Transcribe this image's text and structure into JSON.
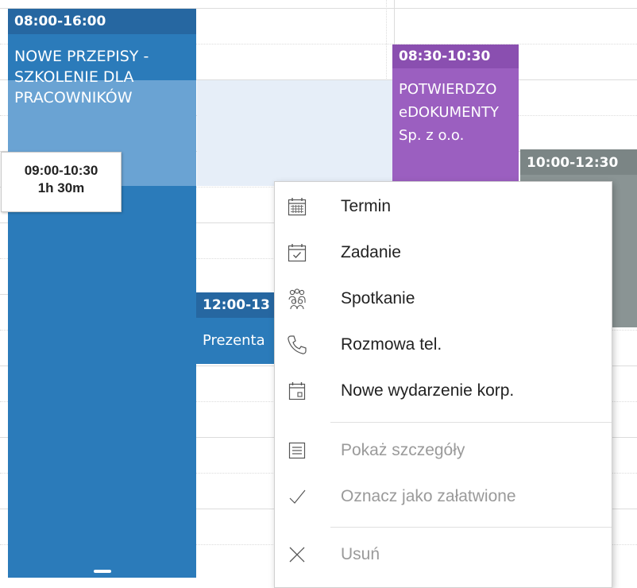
{
  "calendar": {
    "events": [
      {
        "id": "ev1",
        "time": "08:00-16:00",
        "title": "NOWE PRZEPISY -\nSZKOLENIE DLA\nPRACOWNIKÓW",
        "color": "#2b7bba"
      },
      {
        "id": "ev2",
        "time": "08:30-10:30",
        "title": "POTWIERDZO\neDOKUMENTY\nSp. z o.o.",
        "color": "#9b5fc0"
      },
      {
        "id": "ev3",
        "time": "10:00-12:30",
        "title": "",
        "color": "#8a9494"
      },
      {
        "id": "ev4",
        "time": "12:00-13",
        "title": "Prezenta",
        "color": "#2b7bba"
      }
    ],
    "selection_tooltip": {
      "range": "09:00-10:30",
      "duration": "1h 30m"
    }
  },
  "context_menu": {
    "items": [
      {
        "label": "Termin",
        "icon": "calendar-grid-icon",
        "enabled": true
      },
      {
        "label": "Zadanie",
        "icon": "calendar-check-icon",
        "enabled": true
      },
      {
        "label": "Spotkanie",
        "icon": "people-group-icon",
        "enabled": true
      },
      {
        "label": "Rozmowa tel.",
        "icon": "phone-icon",
        "enabled": true
      },
      {
        "label": "Nowe wydarzenie korp.",
        "icon": "calendar-event-icon",
        "enabled": true
      },
      {
        "label": "Pokaż szczegóły",
        "icon": "details-list-icon",
        "enabled": false
      },
      {
        "label": "Oznacz jako załatwione",
        "icon": "checkmark-icon",
        "enabled": false
      },
      {
        "label": "Usuń",
        "icon": "close-x-icon",
        "enabled": false
      }
    ]
  },
  "colors": {
    "accent_blue": "#2b7bba",
    "accent_purple": "#9b5fc0",
    "accent_gray": "#8a9494",
    "selection": "#e6eef8"
  }
}
